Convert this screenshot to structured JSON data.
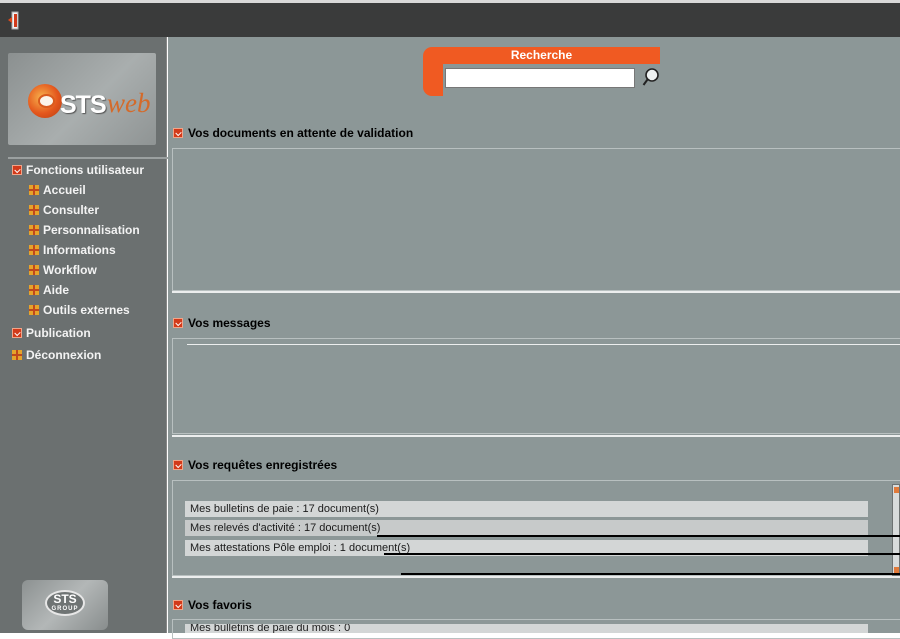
{
  "sidebar": {
    "logo": {
      "brand": "STS",
      "brand_suffix": "web"
    },
    "nav": {
      "section_user": "Fonctions utilisateur",
      "items": [
        {
          "label": "Accueil"
        },
        {
          "label": "Consulter"
        },
        {
          "label": "Personnalisation"
        },
        {
          "label": "Informations"
        },
        {
          "label": "Workflow"
        },
        {
          "label": "Aide"
        },
        {
          "label": "Outils externes"
        }
      ],
      "publication": "Publication",
      "logout": "Déconnexion"
    },
    "footer_logo": {
      "text": "STS",
      "sub": "GROUP"
    }
  },
  "search": {
    "title": "Recherche",
    "value": ""
  },
  "sections": {
    "pending": {
      "title": "Vos documents en attente de validation"
    },
    "messages": {
      "title": "Vos messages"
    },
    "saved_queries": {
      "title": "Vos requêtes enregistrées",
      "rows": [
        "Mes bulletins de paie : 17 document(s)",
        "Mes relevés d'activité : 17 document(s)",
        "Mes attestations Pôle emploi : 1 document(s)"
      ]
    },
    "favorites": {
      "title": "Vos favoris",
      "rows": [
        "Mes bulletins de paie du mois : 0"
      ]
    }
  },
  "colors": {
    "accent": "#f05a22",
    "sidebar": "#6b7070",
    "main_bg": "#8c9797",
    "topbar": "#3a3b3b"
  }
}
